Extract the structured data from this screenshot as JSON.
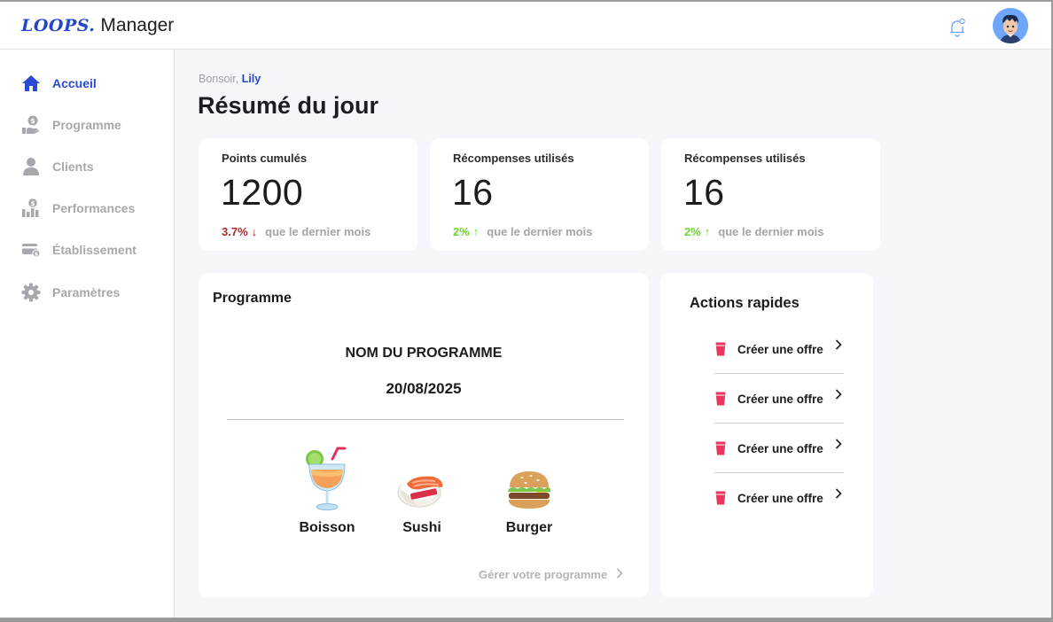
{
  "app": {
    "brand": "LOOPS.",
    "suffix": "Manager"
  },
  "sidebar": {
    "items": [
      {
        "label": "Accueil",
        "icon": "home-icon",
        "active": true
      },
      {
        "label": "Programme",
        "icon": "hand-coin-icon",
        "active": false
      },
      {
        "label": "Clients",
        "icon": "user-icon",
        "active": false
      },
      {
        "label": "Performances",
        "icon": "bar-chart-icon",
        "active": false
      },
      {
        "label": "Établissement",
        "icon": "card-icon",
        "active": false
      },
      {
        "label": "Paramètres",
        "icon": "gear-icon",
        "active": false
      }
    ]
  },
  "main": {
    "greeting_prefix": "Bonsoir, ",
    "user_name": "Lily",
    "title": "Résumé du jour"
  },
  "stats": [
    {
      "title": "Points cumulés",
      "value": "1200",
      "change": "3.7%",
      "direction": "down",
      "compare": "que le dernier mois"
    },
    {
      "title": "Récompenses utilisés",
      "value": "16",
      "change": "2%",
      "direction": "up",
      "compare": "que le dernier mois"
    },
    {
      "title": "Récompenses utilisés",
      "value": "16",
      "change": "2%",
      "direction": "up",
      "compare": "que le dernier mois"
    }
  ],
  "programme": {
    "heading": "Programme",
    "name": "NOM DU PROGRAMME",
    "date": "20/08/2025",
    "rewards": [
      {
        "label": "Boisson",
        "icon": "cocktail-icon"
      },
      {
        "label": "Sushi",
        "icon": "sushi-icon"
      },
      {
        "label": "Burger",
        "icon": "burger-icon"
      }
    ],
    "manage_link": "Gérer votre programme"
  },
  "quick_actions": {
    "heading": "Actions rapides",
    "items": [
      {
        "label": "Créer une offre",
        "icon": "cup-icon"
      },
      {
        "label": "Créer une offre",
        "icon": "cup-icon"
      },
      {
        "label": "Créer une offre",
        "icon": "cup-icon"
      },
      {
        "label": "Créer une offre",
        "icon": "cup-icon"
      }
    ]
  },
  "colors": {
    "accent": "#2a4ad1",
    "down": "#b3262b",
    "up": "#6bd62f",
    "quick_icon": "#e8365f",
    "background": "#f6f7fb"
  }
}
